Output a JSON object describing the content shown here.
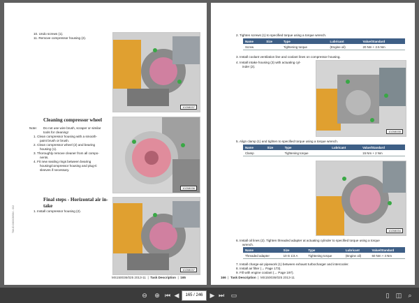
{
  "left": {
    "steps_a": [
      {
        "num": "10.",
        "text": "Undo screws (1)."
      },
      {
        "num": "11.",
        "text": "Remove compressor housing (2)."
      }
    ],
    "fig1_id": "10208037",
    "section1_title": "Cleaning compressor wheel",
    "note_label": "Note:",
    "note_lines": [
      "Do not use wire brush, scraper or similar",
      "tools for cleaning!"
    ],
    "clean_lines": [
      {
        "num": "1.",
        "text": "Clean compressor housing with a smooth-"
      },
      {
        "num": "",
        "text": "paint brush or brush."
      },
      {
        "num": "2.",
        "text": "Clean compressor wheel (2) and bearing"
      },
      {
        "num": "",
        "text": "housing (1)."
      },
      {
        "num": "3.",
        "text": "Thoroughly remove cleaner from all compo-"
      },
      {
        "num": "",
        "text": "nents."
      },
      {
        "num": "4.",
        "text": "Fit new sealing rings between bearing"
      },
      {
        "num": "",
        "text": "housing/compressor housing and plug-ti"
      },
      {
        "num": "",
        "text": "sleeves if necessary."
      }
    ],
    "fig2_id": "10208036",
    "section2_title_lines": [
      "Final steps - Horizontal air in-",
      "take"
    ],
    "final_steps": [
      {
        "num": "1.",
        "text": "Install compressor housing (2)."
      }
    ],
    "fig3_id": "10208037",
    "footer_doc": "MS150036/025 2013-11",
    "footer_section": "Task Description",
    "footer_page": "165",
    "vertical_code": "TIM-ID:0000036584 - 002"
  },
  "right": {
    "step2": {
      "num": "2.",
      "text": "Tighten screws (1) to specified torque using a torque wrench."
    },
    "table1": {
      "headers": [
        "Name",
        "Size",
        "Type",
        "Lubricant",
        "Value/Standard"
      ],
      "row": [
        "Screw",
        "",
        "Tightening torque",
        "(Engine oil)",
        "20 Nm + 2.5 Nm"
      ]
    },
    "step3": {
      "num": "3.",
      "text": "Install coolant ventilation line and coolant lines on compressor housing."
    },
    "step4_lines": [
      {
        "num": "4.",
        "text": "Install intake housing (3) with actuating cyl-"
      },
      {
        "num": "",
        "text": "inder (2)."
      }
    ],
    "fig4_id": "10208035",
    "step5": {
      "num": "5.",
      "text": "Align clamp (1) and tighten to specified torque using a torque wrench."
    },
    "table2": {
      "headers": [
        "Name",
        "Size",
        "Type",
        "Lubricant",
        "Value/Standard"
      ],
      "row": [
        "Clamp",
        "",
        "Tightening torque",
        "",
        "15 Nm + 2 Nm"
      ]
    },
    "fig5_id": "10208034",
    "step6_lines": [
      {
        "num": "6.",
        "text": "Install oil lines (2). Tighten threaded adapter at actuating cylinder to specified torque using a torque"
      },
      {
        "num": "",
        "text": "wrench."
      }
    ],
    "table3": {
      "headers": [
        "Name",
        "Size",
        "Type",
        "Lubricant",
        "Value/Standard"
      ],
      "row": [
        "Threaded adapter",
        "10 G 1/4 A",
        "Tightening torque",
        "(Engine oil)",
        "60 Nm + 4 Nm"
      ]
    },
    "tail_steps": [
      {
        "num": "7.",
        "text": "Install charge-air pipework (1) between exhaust turbocharger and intercooler."
      },
      {
        "num": "8.",
        "text": "Install air filter (→ Page 173)."
      },
      {
        "num": "9.",
        "text": "Fill with engine coolant (→ Page 197)."
      }
    ],
    "footer_page": "166",
    "footer_section": "Task Description",
    "footer_doc": "MS150036/025 2013-11"
  },
  "toolbar": {
    "page_value": "165 / 246",
    "zoom_icon": "magnifier-icon"
  }
}
